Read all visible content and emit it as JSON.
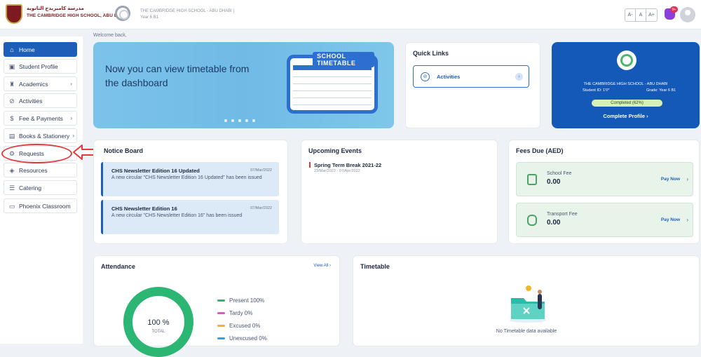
{
  "header": {
    "school_arabic": "مدرسة كامبريدج الثانوية",
    "school_name": "THE CAMBRIDGE HIGH SCHOOL, ABU DHABI",
    "school_line": "THE CAMBRIDGE HIGH SCHOOL - ABU DHABI |",
    "grade_line": "Year 6 B1",
    "font_controls": [
      "A-",
      "A",
      "A+"
    ],
    "notification_count": "9+"
  },
  "sidebar": {
    "items": [
      {
        "label": "Home",
        "icon": "home-icon",
        "active": true
      },
      {
        "label": "Student Profile",
        "icon": "profile-icon"
      },
      {
        "label": "Academics",
        "icon": "academics-icon",
        "has_submenu": true
      },
      {
        "label": "Activities",
        "icon": "activities-icon"
      },
      {
        "label": "Fee & Payments",
        "icon": "fee-icon",
        "has_submenu": true
      },
      {
        "label": "Books & Stationery",
        "icon": "books-icon",
        "has_submenu": true
      },
      {
        "label": "Requests",
        "icon": "requests-icon"
      },
      {
        "label": "Resources",
        "icon": "resources-icon"
      },
      {
        "label": "Catering",
        "icon": "catering-icon"
      },
      {
        "label": "Phoenix Classroom",
        "icon": "classroom-icon"
      }
    ]
  },
  "main": {
    "welcome": "Welcome back,",
    "banner": {
      "text": "Now you can view timetable from the dashboard",
      "board_title": "SCHOOL TIMETABLE"
    },
    "quick_links": {
      "title": "Quick Links",
      "items": [
        {
          "label": "Activities"
        }
      ]
    },
    "profile": {
      "school": "THE CAMBRIDGE HIGH SCHOOL - ABU DHABI",
      "student_id": "Student ID: 1'0*",
      "grade": "Grade: Year 6 B1",
      "progress_label": "Completed (62%)",
      "progress": 62,
      "cta": "Complete Profile"
    },
    "notice_board": {
      "title": "Notice Board",
      "notices": [
        {
          "title": "CHS Newsletter Edition 16 Updated",
          "date": "07/Mar/2022",
          "body": "A new circular \"CHS Newsletter Edition 16 Updated\" has been issued"
        },
        {
          "title": "CHS Newsletter Edition 16",
          "date": "07/Mar/2022",
          "body": "A new circular \"CHS Newsletter Edition 16\" has been issued"
        }
      ]
    },
    "events": {
      "title": "Upcoming Events",
      "items": [
        {
          "title": "Spring Term Break 2021-22",
          "date": "23/Mar/2022 - 07/Apr/2022"
        }
      ]
    },
    "fees": {
      "title": "Fees Due (AED)",
      "items": [
        {
          "name": "School Fee",
          "amount": "0.00",
          "action": "Pay Now"
        },
        {
          "name": "Transport Fee",
          "amount": "0.00",
          "action": "Pay Now"
        }
      ]
    },
    "attendance": {
      "title": "Attendance",
      "view_all": "View All",
      "total_value": "100 %",
      "total_label": "TOTAL",
      "legend": [
        {
          "label": "Present 100%",
          "color": "#2bb673"
        },
        {
          "label": "Tardy 0%",
          "color": "#d65cc3"
        },
        {
          "label": "Excused 0%",
          "color": "#f0b429"
        },
        {
          "label": "Unexcused 0%",
          "color": "#2aa6e0"
        }
      ]
    },
    "timetable": {
      "title": "Timetable",
      "empty": "No Timetable data available"
    }
  },
  "colors": {
    "accent": "#1c5eb8",
    "annotation": "#e23b3b"
  }
}
